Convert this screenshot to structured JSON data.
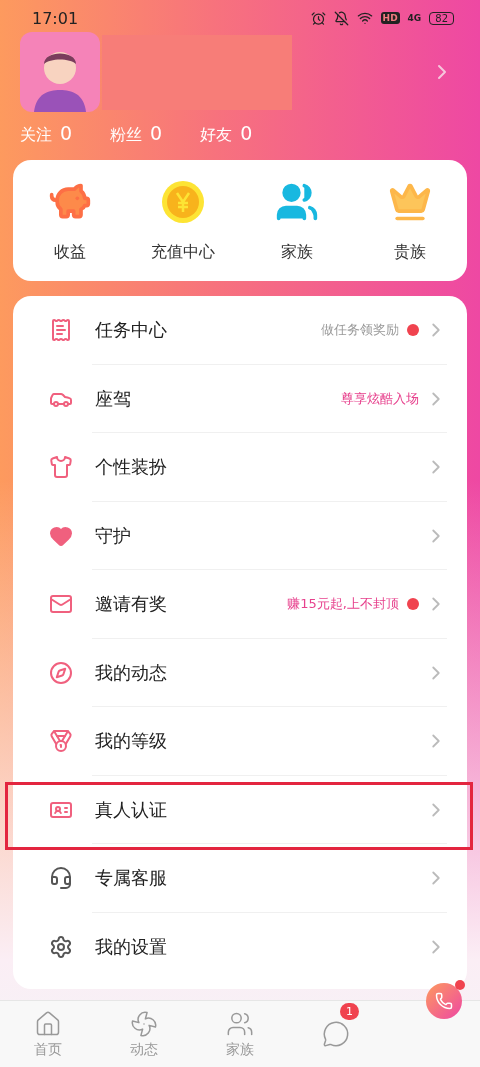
{
  "status_bar": {
    "time": "17:01",
    "network": "4G",
    "hd": "HD",
    "battery": "82"
  },
  "profile": {
    "stats": [
      {
        "label": "关注",
        "value": "0"
      },
      {
        "label": "粉丝",
        "value": "0"
      },
      {
        "label": "好友",
        "value": "0"
      }
    ]
  },
  "quick_actions": [
    {
      "label": "收益"
    },
    {
      "label": "充值中心"
    },
    {
      "label": "家族"
    },
    {
      "label": "贵族"
    }
  ],
  "menu": [
    {
      "label": "任务中心",
      "hint": "做任务领奖励",
      "hint_accent": false,
      "dot": true,
      "highlighted": false
    },
    {
      "label": "座驾",
      "hint": "尊享炫酷入场",
      "hint_accent": true,
      "dot": false,
      "highlighted": false
    },
    {
      "label": "个性装扮",
      "dot": false,
      "highlighted": false
    },
    {
      "label": "守护",
      "dot": false,
      "highlighted": false
    },
    {
      "label": "邀请有奖",
      "hint": "赚15元起,上不封顶",
      "hint_accent": true,
      "dot": true,
      "highlighted": false
    },
    {
      "label": "我的动态",
      "dot": false,
      "highlighted": false
    },
    {
      "label": "我的等级",
      "dot": false,
      "highlighted": false
    },
    {
      "label": "真人认证",
      "dot": false,
      "highlighted": true
    },
    {
      "label": "专属客服",
      "dot": false,
      "highlighted": false
    },
    {
      "label": "我的设置",
      "dot": false,
      "highlighted": false
    }
  ],
  "bottom_nav": [
    {
      "label": "首页",
      "selected": false
    },
    {
      "label": "动态",
      "selected": false
    },
    {
      "label": "家族",
      "selected": false
    },
    {
      "badge": "1",
      "selected": false
    }
  ]
}
